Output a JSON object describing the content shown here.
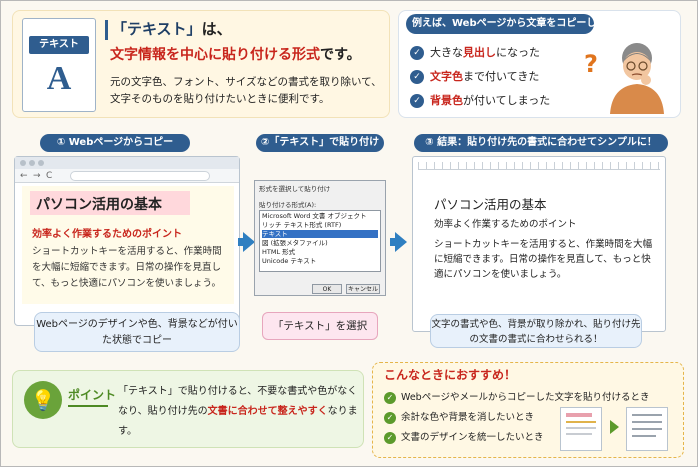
{
  "intro": {
    "doc_tag": "テキスト",
    "doc_letter": "A",
    "title": "「テキスト」",
    "title_particle": "は、",
    "main_highlight": "文字情報を中心に貼り付ける形式",
    "main_tail": "です。",
    "desc": "元の文字色、フォント、サイズなどの書式を取り除いて、文字そのものを貼り付けたいときに便利です。"
  },
  "example": {
    "header": "例えば、Webページから文章をコピーしたら…",
    "items": [
      {
        "pre": "大きな",
        "hl": "見出し",
        "post": "になった"
      },
      {
        "pre": "",
        "hl": "文字色",
        "post": "まで付いてきた"
      },
      {
        "pre": "",
        "hl": "背景色",
        "post": "が付いてしまった"
      }
    ],
    "question_mark": "?"
  },
  "steps": {
    "one": "① Webページからコピー",
    "two": "②「テキスト」で貼り付け",
    "three": "③ 結果：貼り付け先の書式に合わせてシンプルに！"
  },
  "browser": {
    "page_title": "パソコン活用の基本",
    "page_sub": "効率よく作業するためのポイント",
    "page_text": "ショートカットキーを活用すると、作業時間を大幅に短縮できます。日常の操作を見直して、もっと快適にパソコンを使いましょう。",
    "nav": [
      "←",
      "→",
      "C"
    ],
    "callout": "Webページのデザインや色、背景などが付いた状態でコピー"
  },
  "dialog": {
    "title": "形式を選択して貼り付け",
    "label": "貼り付ける形式(A):",
    "options": [
      "Microsoft Word 文書 オブジェクト",
      "リッチ テキスト形式 (RTF)",
      "テキスト",
      "図 (拡張メタファイル)",
      "HTML 形式",
      "Unicode テキスト"
    ],
    "selected_index": 2,
    "ok": "OK",
    "cancel": "キャンセル",
    "callout": "「テキスト」を選択"
  },
  "result": {
    "title": "パソコン活用の基本",
    "sub": "効率よく作業するためのポイント",
    "text": "ショートカットキーを活用すると、作業時間を大幅に短縮できます。日常の操作を見直して、もっと快適にパソコンを使いましょう。",
    "callout": "文字の書式や色、背景が取り除かれ、貼り付け先の文書の書式に合わせられる！"
  },
  "point": {
    "label": "ポイント",
    "text_pre": "「テキスト」で貼り付けると、不要な書式や色がなくなり、貼り付け先の",
    "text_hl": "文書に合わせて整えやすく",
    "text_post": "なります。"
  },
  "recommend": {
    "title": "こんなときにおすすめ！",
    "items": [
      "Webページやメールからコピーした文字を貼り付けるとき",
      "余計な色や背景を消したいとき",
      "文書のデザインを統一したいとき"
    ]
  },
  "colors": {
    "accent_blue": "#2f5d8f",
    "highlight_red": "#c8261d",
    "point_green": "#4e8a24",
    "arrow_blue": "#2f7fc1"
  }
}
